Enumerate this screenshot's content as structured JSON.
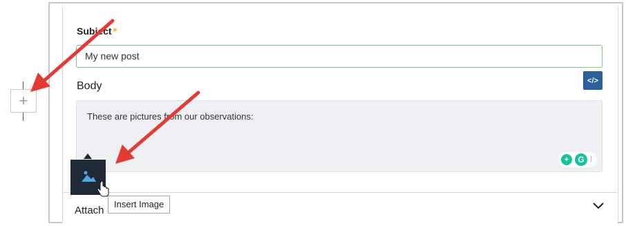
{
  "form": {
    "subject_label": "Subject",
    "required_mark": "*",
    "subject_value": "My new post",
    "body_label": "Body",
    "body_text": "These are pictures from our observations:",
    "attachments_label": "Attach",
    "code_button_glyph": "</>"
  },
  "toolbar": {
    "add_button_glyph": "+",
    "insert_image_tooltip": "Insert Image"
  },
  "grammarly": {
    "bulb_glyph": "💡",
    "logo_glyph": "G",
    "extra_glyph": "ꟷ"
  },
  "icons": {
    "add": "plus-icon",
    "image": "image-icon",
    "code": "code-icon",
    "chevron": "chevron-down-icon",
    "cursor": "hand-pointer-icon",
    "arrows": "red-arrow-annotation"
  },
  "colors": {
    "arrow": "#e53935",
    "subject_border": "#7cc98a",
    "code_button": "#2d5f9e",
    "image_button": "#1f2a36",
    "required": "#f2b705",
    "grammarly": "#15c39a"
  }
}
